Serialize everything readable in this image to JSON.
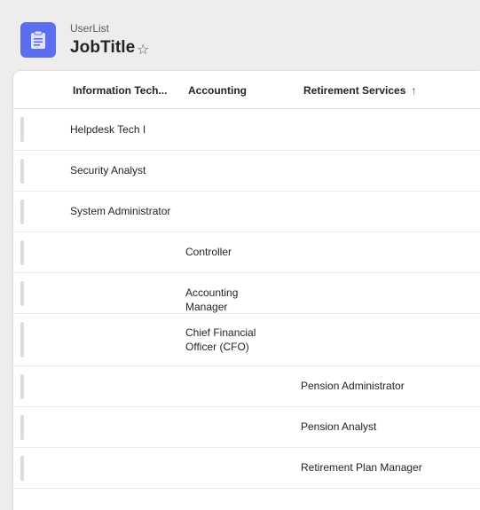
{
  "header": {
    "subtitle": "UserList",
    "title": "JobTitle",
    "star": "☆",
    "app_icon": "clipboard-icon",
    "accent_color": "#5b6ef0"
  },
  "columns": {
    "information_technology": "Information Tech...",
    "accounting": "Accounting",
    "retirement_services": "Retirement Services",
    "sort_indicator": "↑"
  },
  "rows": [
    {
      "column": "information_technology",
      "text": "Helpdesk Tech I"
    },
    {
      "column": "information_technology",
      "text": "Security Analyst"
    },
    {
      "column": "information_technology",
      "text": "System Administrator"
    },
    {
      "column": "accounting",
      "text": "Controller"
    },
    {
      "column": "accounting",
      "text": "Accounting Manager"
    },
    {
      "column": "accounting",
      "text": "Chief Financial Officer (CFO)"
    },
    {
      "column": "retirement_services",
      "text": "Pension Administrator"
    },
    {
      "column": "retirement_services",
      "text": "Pension Analyst"
    },
    {
      "column": "retirement_services",
      "text": "Retirement Plan Manager"
    }
  ]
}
